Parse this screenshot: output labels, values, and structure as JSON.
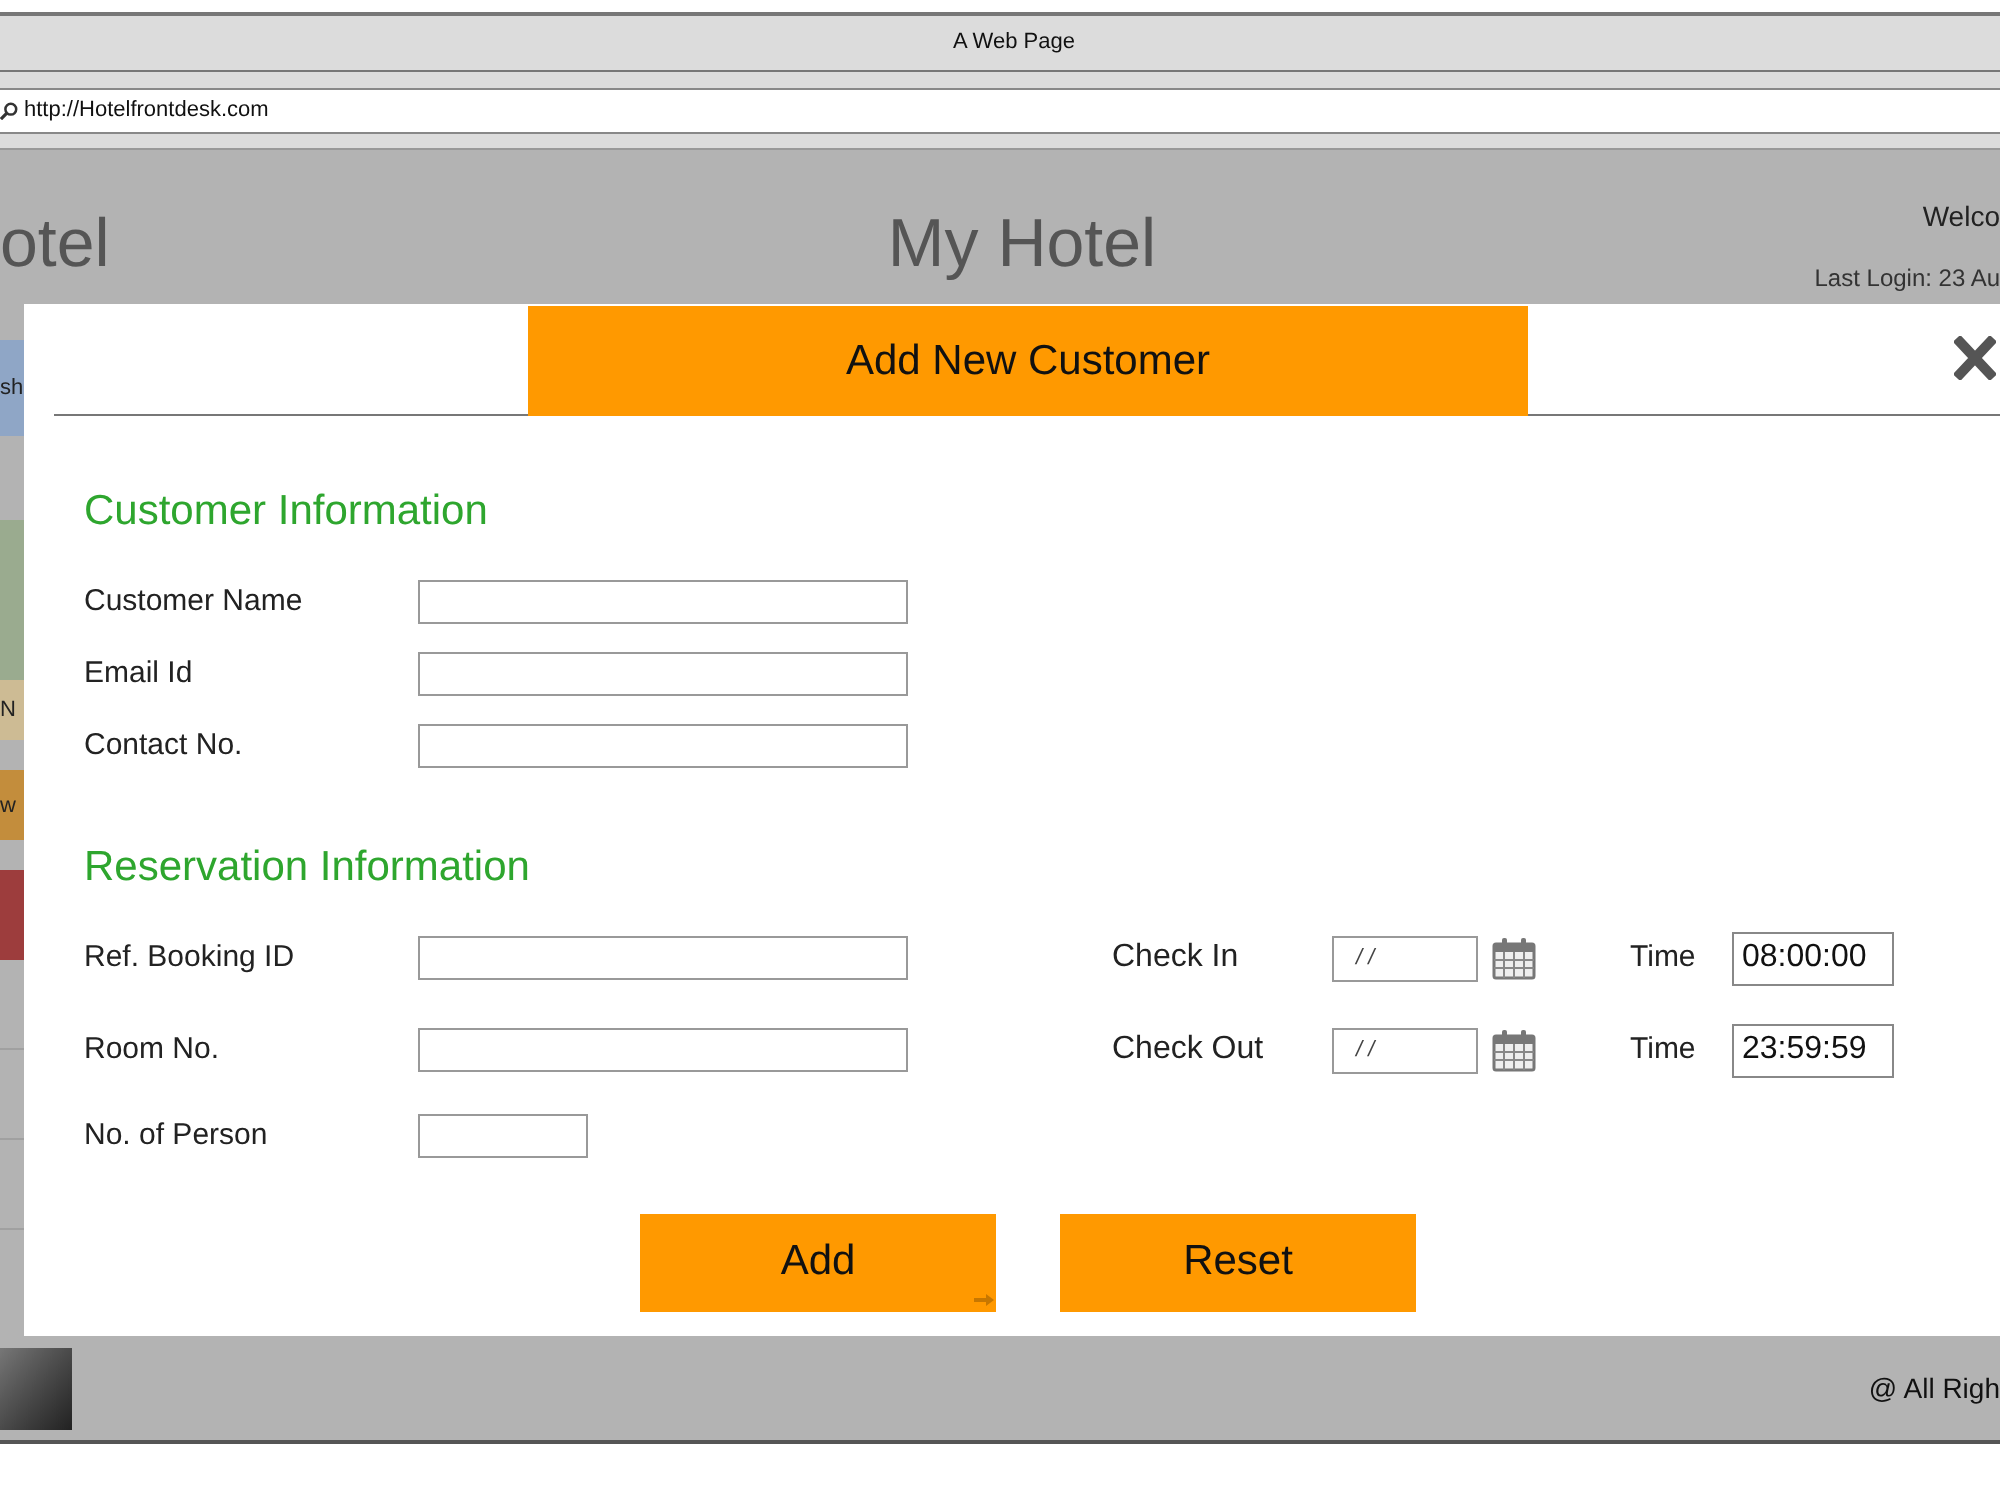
{
  "window": {
    "title": "A Web Page"
  },
  "address_bar": {
    "url": "http://Hotelfrontdesk.com"
  },
  "header": {
    "logo": "otel",
    "title": "My Hotel",
    "welcome": "Welco",
    "last_login": "Last Login: 23 Au"
  },
  "sidebar": {
    "items": [
      {
        "label": "sh",
        "color": "#8fa6c6"
      },
      {
        "color": "#9aab8f"
      },
      {
        "label": "N",
        "color": "#cdbb94"
      },
      {
        "label": "w",
        "color": "#c38d3c"
      },
      {
        "color": "#9d3d3d"
      }
    ]
  },
  "dialog": {
    "title": "Add New Customer",
    "customer": {
      "heading": "Customer Information",
      "fields": [
        {
          "label": "Customer Name"
        },
        {
          "label": "Email Id"
        },
        {
          "label": "Contact No."
        }
      ]
    },
    "reservation": {
      "heading": "Reservation Information",
      "fields": [
        {
          "label": "Ref. Booking ID",
          "kind": "wide"
        },
        {
          "label": "Room No.",
          "kind": "wide"
        },
        {
          "label": "No. of Person",
          "kind": "narrow"
        }
      ],
      "schedule": [
        {
          "label": "Check In",
          "date": "/ /",
          "time_label": "Time",
          "time": "08:00:00"
        },
        {
          "label": "Check Out",
          "date": "/ /",
          "time_label": "Time",
          "time": "23:59:59"
        }
      ]
    },
    "buttons": [
      {
        "label": "Add"
      },
      {
        "label": "Reset"
      }
    ]
  },
  "footer": {
    "text": "@ All Righ"
  }
}
